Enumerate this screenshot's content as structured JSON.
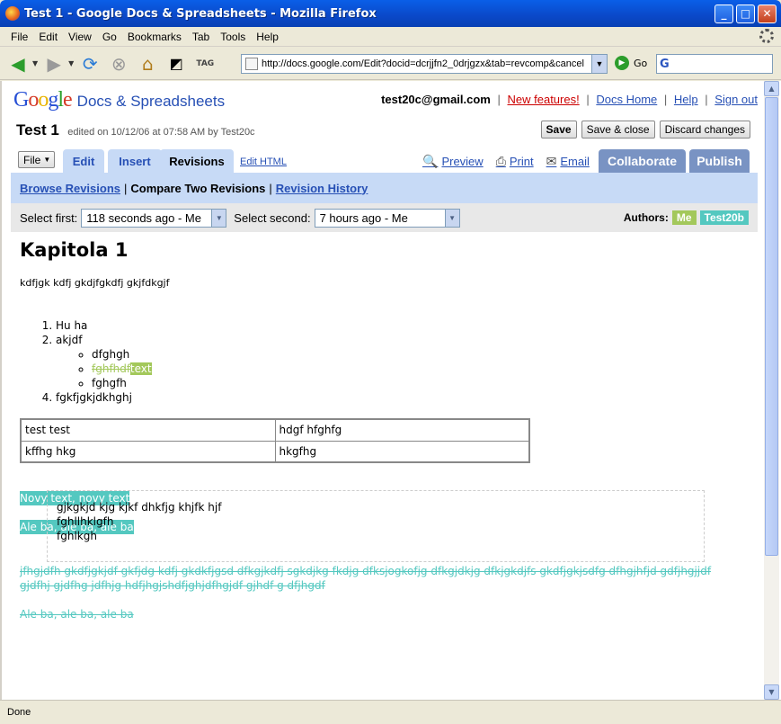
{
  "window": {
    "title": "Test 1 - Google Docs & Spreadsheets - Mozilla Firefox",
    "controls": [
      "_",
      "□",
      "✕"
    ]
  },
  "menu": [
    "File",
    "Edit",
    "View",
    "Go",
    "Bookmarks",
    "Tab",
    "Tools",
    "Help"
  ],
  "nav": {
    "url": "http://docs.google.com/Edit?docid=dcrjjfn2_0drjgzx&tab=revcomp&cancel",
    "go_label": "Go",
    "tag_label": "TAG",
    "search_icon": "G"
  },
  "status": "Done",
  "header": {
    "logo_google": "Google",
    "logo_sub": "Docs & Spreadsheets",
    "email": "test20c@gmail.com",
    "links": [
      "New features!",
      "Docs Home",
      "Help",
      "Sign out"
    ],
    "link_sep": "|"
  },
  "doc_meta": {
    "title": "Test 1",
    "edited": "edited on 10/12/06 at 07:58 AM by Test20c"
  },
  "actions": {
    "save": "Save",
    "save_close": "Save & close",
    "discard": "Discard changes"
  },
  "tabs": {
    "file": "File",
    "items": [
      "Edit",
      "Insert",
      "Revisions"
    ],
    "edit_html": "Edit HTML",
    "preview": "Preview",
    "print": "Print",
    "email": "Email",
    "collaborate": "Collaborate",
    "publish": "Publish"
  },
  "revisions": {
    "browse": "Browse Revisions",
    "compare": "Compare Two Revisions",
    "history": "Revision History",
    "sep": "|",
    "select_first_label": "Select first:",
    "select_first_value": "118 seconds ago - Me",
    "select_second_label": "Select second:",
    "select_second_value": "7 hours ago - Me",
    "authors_label": "Authors:",
    "authors": [
      {
        "name": "Me",
        "color": "#a3c85b"
      },
      {
        "name": "Test20b",
        "color": "#54c8c0"
      }
    ]
  },
  "document": {
    "heading": "Kapitola 1",
    "para1": "kdfjgk kdfj gkdjfgkdfj gkjfdkgjf",
    "list": {
      "item1": "Hu ha",
      "item2": "akjdf",
      "sub1": "dfghgh",
      "sub2_deleted": "fghfhdf",
      "sub2_inserted": "text",
      "sub3": "fghgfh",
      "item4": "fgkfjgkjdkhghj"
    },
    "table": [
      [
        "test test",
        "hdgf hfghfg"
      ],
      [
        "kffhg hkg",
        "hkgfhg"
      ]
    ],
    "inserted1": "Novy text, novy text",
    "inserted2": "Ale ba, ale ba, ale ba",
    "deleted1": "jfhgjdfh gkdfjgkjdf gkfjdg kdfj gkdkfjgsd dfkgjkdfj sgkdjkg fkdjg dfksjogkofjg dfkgjdkjg dfkjgkdjfs gkdfjgkjsdfg dfhgjhfjd gdfjhgjjdf gjdfhj gjdfhg jdfhjg hdfjhgjshdfjghjdfhgjdf gjhdf g dfjhgdf",
    "deleted2": "Ale ba, ale ba, ale ba",
    "box_lines": [
      "gjkgkjd kjg kjkf dhkfjg khjfk hjf",
      "fghllhklgfh",
      "fghlkgh"
    ]
  }
}
